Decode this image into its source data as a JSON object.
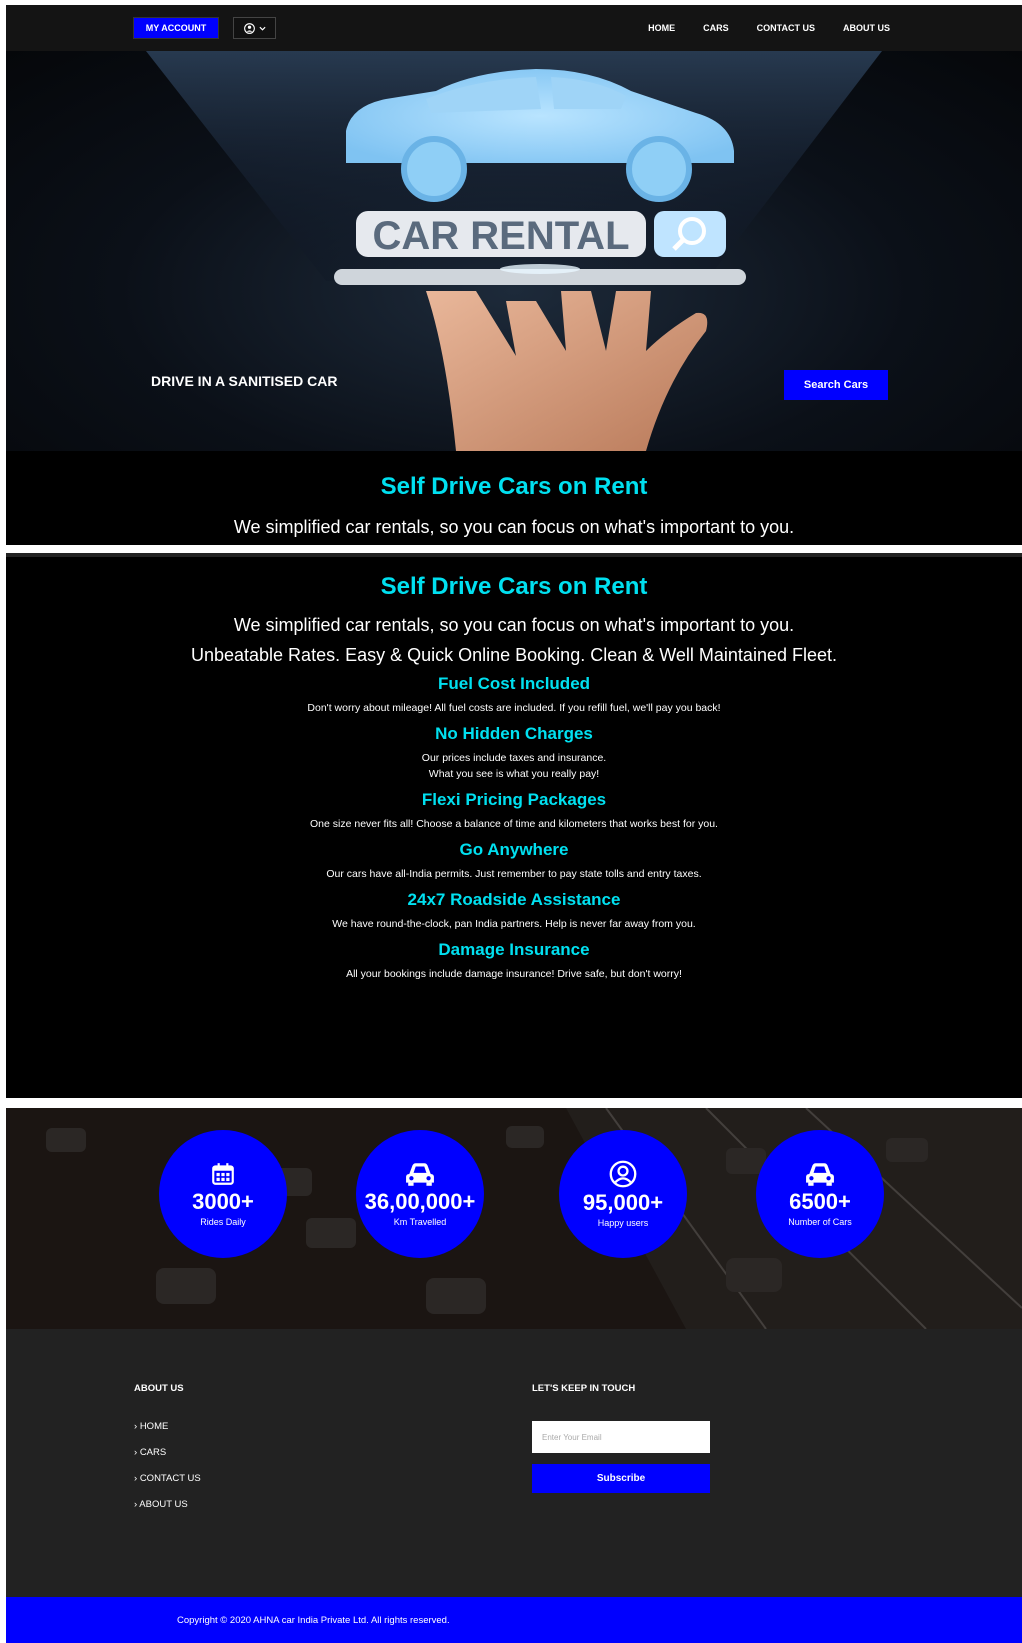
{
  "header": {
    "account_label": "MY ACCOUNT",
    "nav": [
      "HOME",
      "CARS",
      "CONTACT US",
      "ABOUT US"
    ]
  },
  "hero": {
    "image_text": "CAR RENTAL",
    "tagline": "DRIVE IN A SANITISED CAR",
    "search_label": "Search Cars"
  },
  "intro": {
    "title": "Self Drive Cars on Rent",
    "subtitle": "We simplified car rentals, so you can focus on what's important to you.",
    "tagline": "Unbeatable Rates. Easy & Quick Online Booking. Clean & Well Maintained Fleet."
  },
  "features": [
    {
      "title": "Fuel Cost Included",
      "lines": [
        "Don't worry about mileage! All fuel costs are included. If you refill fuel, we'll pay you back!"
      ]
    },
    {
      "title": "No Hidden Charges",
      "lines": [
        "Our prices include taxes and insurance.",
        "What you see is what you really pay!"
      ]
    },
    {
      "title": "Flexi Pricing Packages",
      "lines": [
        "One size never fits all! Choose a balance of time and kilometers that works best for you."
      ]
    },
    {
      "title": "Go Anywhere",
      "lines": [
        "Our cars have all-India permits. Just remember to pay state tolls and entry taxes."
      ]
    },
    {
      "title": "24x7 Roadside Assistance",
      "lines": [
        "We have round-the-clock, pan India partners. Help is never far away from you."
      ]
    },
    {
      "title": "Damage Insurance",
      "lines": [
        "All your bookings include damage insurance! Drive safe, but don't worry!"
      ]
    }
  ],
  "stats": [
    {
      "icon": "calendar-icon",
      "number": "3000+",
      "label": "Rides Daily"
    },
    {
      "icon": "car-icon",
      "number": "36,00,000+",
      "label": "Km Travelled"
    },
    {
      "icon": "user-icon",
      "number": "95,000+",
      "label": "Happy users"
    },
    {
      "icon": "car-icon",
      "number": "6500+",
      "label": "Number of Cars"
    }
  ],
  "footer": {
    "about_heading": "ABOUT US",
    "links": [
      "HOME",
      "CARS",
      "CONTACT US",
      "ABOUT US"
    ],
    "touch_heading": "LET'S KEEP IN TOUCH",
    "email_placeholder": "Enter Your Email",
    "subscribe_label": "Subscribe",
    "copyright": "Copyright © 2020 AHNA car India Private Ltd. All rights reserved."
  },
  "colors": {
    "accent": "#0000ff",
    "heading": "#00e0f0",
    "footer_bg": "#222222"
  }
}
